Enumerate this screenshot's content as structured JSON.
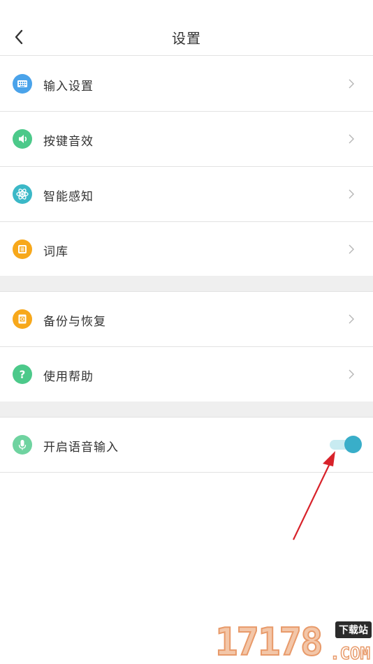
{
  "header": {
    "title": "设置"
  },
  "group1": [
    {
      "label": "输入设置",
      "icon": "keyboard-icon",
      "color": "#4aa3ea"
    },
    {
      "label": "按键音效",
      "icon": "speaker-icon",
      "color": "#4cc98a"
    },
    {
      "label": "智能感知",
      "icon": "atom-icon",
      "color": "#3bb8c7"
    },
    {
      "label": "词库",
      "icon": "dictionary-icon",
      "color": "#f7a81b"
    }
  ],
  "group2": [
    {
      "label": "备份与恢复",
      "icon": "backup-icon",
      "color": "#f7a81b"
    },
    {
      "label": "使用帮助",
      "icon": "help-icon",
      "color": "#4cc98a"
    }
  ],
  "group3": [
    {
      "label": "开启语音输入",
      "icon": "microphone-icon",
      "color": "#6fd3a0",
      "toggle_on": true
    }
  ],
  "watermark": {
    "brand": "17178",
    "badge": "下载站",
    "domain": ".COM"
  },
  "colors": {
    "accent": "#39aec9",
    "annotation_arrow": "#d8222a"
  }
}
